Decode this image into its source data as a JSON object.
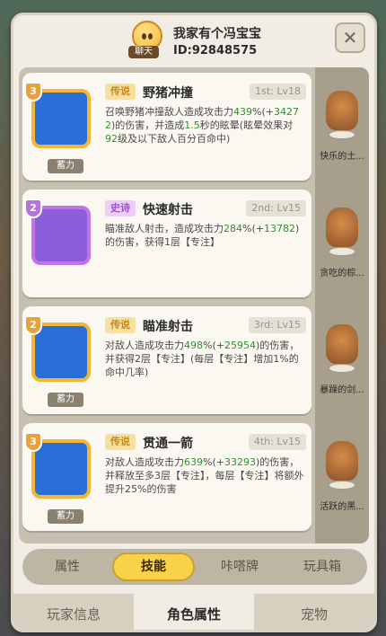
{
  "header": {
    "chat_label": "聊天",
    "player_name": "我家有个冯宝宝",
    "player_id": "ID:92848575",
    "close_label": "✕"
  },
  "skills": [
    {
      "rank": "3",
      "rarity": "传说",
      "name": "野猪冲撞",
      "level": "1st: Lv18",
      "desc_parts": [
        "召唤野猪冲撞敌人造成攻击力",
        "439",
        "%(+",
        "3427",
        "2",
        ")的伤害，并造成",
        "1.5",
        "秒的眩晕(眩晕效果对",
        "92",
        "级及以下敌人百分百命中)"
      ],
      "tag": "蓄力"
    },
    {
      "rank": "2",
      "rarity": "史诗",
      "name": "快速射击",
      "level": "2nd: Lv15",
      "desc_parts": [
        "瞄准敌人射击，造成攻击力",
        "284",
        "%(+",
        "13782",
        ")的伤害，获得1层【专注】"
      ],
      "tag": ""
    },
    {
      "rank": "2",
      "rarity": "传说",
      "name": "瞄准射击",
      "level": "3rd: Lv15",
      "desc_parts": [
        "对敌人造成攻击力",
        "498",
        "%(+",
        "25954",
        ")的伤害，并获得2层【专注】(每层【专注】增加1%的命中几率)"
      ],
      "tag": "蓄力"
    },
    {
      "rank": "3",
      "rarity": "传说",
      "name": "贯通一箭",
      "level": "4th: Lv15",
      "desc_parts": [
        "对敌人造成攻击力",
        "639",
        "%(+",
        "33293",
        ")的伤害，并释放至多3层【专注】，每层【专注】将额外提升25%的伤害"
      ],
      "tag": "蓄力"
    }
  ],
  "pets": [
    {
      "name": "快乐的土..."
    },
    {
      "name": "贪吃的棕..."
    },
    {
      "name": "暴躁的剑..."
    },
    {
      "name": "活跃的黑..."
    }
  ],
  "subtabs": [
    "属性",
    "技能",
    "咔嗒牌",
    "玩具箱"
  ],
  "bottom_tabs": [
    "玩家信息",
    "角色属性",
    "宠物"
  ]
}
